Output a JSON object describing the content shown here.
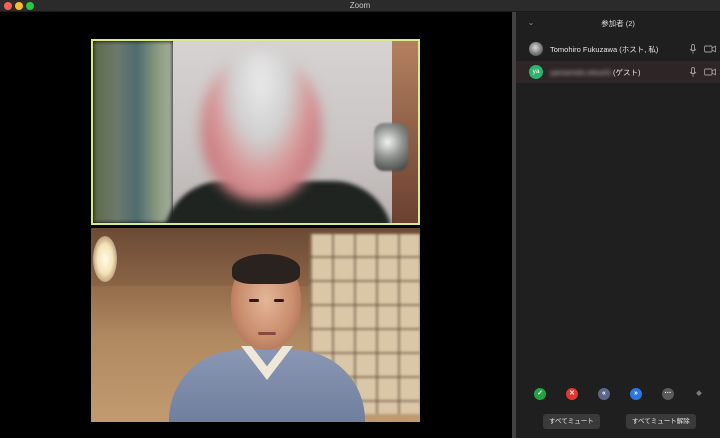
{
  "window": {
    "title": "Zoom"
  },
  "panel": {
    "title": "参加者 (2)",
    "participants": [
      {
        "name": "Tomohiro Fukuzawa",
        "suffix": " (ホスト, 私)",
        "avatar": "photo"
      },
      {
        "name": "yamamoto.otsuchi",
        "suffix": " (ゲスト)",
        "avatar_initials": "ya",
        "avatar_color": "#2fb36a"
      }
    ],
    "reactions": [
      {
        "name": "yes",
        "glyph": "✓",
        "color": "#25a244"
      },
      {
        "name": "no",
        "glyph": "✕",
        "color": "#e0372f"
      },
      {
        "name": "slow-down",
        "glyph": "«",
        "color": "#5c6785"
      },
      {
        "name": "speed-up",
        "glyph": "»",
        "color": "#2a77e0"
      },
      {
        "name": "more",
        "glyph": "···",
        "color": "#5a5a5a"
      },
      {
        "name": "clear",
        "glyph": "◆",
        "color": "#7a7a7a"
      }
    ],
    "buttons": {
      "mute_all": "すべてミュート",
      "unmute_all": "すべてミュート解除"
    }
  },
  "colors": {
    "active_speaker_border": "#d9ea8a",
    "panel_bg": "#1f1f1f"
  }
}
